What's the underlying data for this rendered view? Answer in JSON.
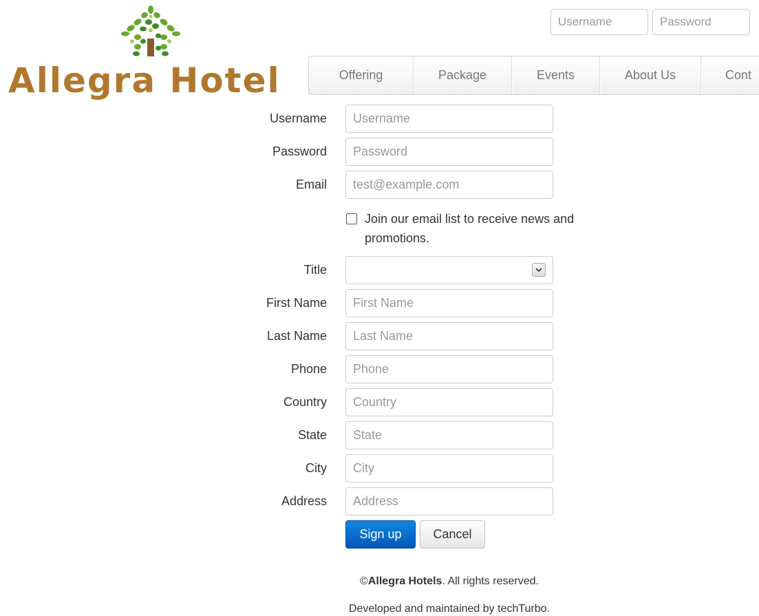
{
  "brand": {
    "name": "Allegra Hotel",
    "color": "#b0782e"
  },
  "top_login": {
    "username_placeholder": "Username",
    "password_placeholder": "Password"
  },
  "nav": {
    "items": [
      "Offering",
      "Package",
      "Events",
      "About Us",
      "Cont"
    ]
  },
  "form": {
    "username": {
      "label": "Username",
      "placeholder": "Username"
    },
    "password": {
      "label": "Password",
      "placeholder": "Password"
    },
    "email": {
      "label": "Email",
      "placeholder": "test@example.com"
    },
    "newsletter": {
      "text": "Join our email list to receive news and promotions.",
      "checked": false
    },
    "title": {
      "label": "Title",
      "value": ""
    },
    "first_name": {
      "label": "First Name",
      "placeholder": "First Name"
    },
    "last_name": {
      "label": "Last Name",
      "placeholder": "Last Name"
    },
    "phone": {
      "label": "Phone",
      "placeholder": "Phone"
    },
    "country": {
      "label": "Country",
      "placeholder": "Country"
    },
    "state": {
      "label": "State",
      "placeholder": "State"
    },
    "city": {
      "label": "City",
      "placeholder": "City"
    },
    "address": {
      "label": "Address",
      "placeholder": "Address"
    }
  },
  "buttons": {
    "signup": "Sign up",
    "cancel": "Cancel",
    "primary_color": "#0b6fd0"
  },
  "footer": {
    "copyright_symbol": "©",
    "company": "Allegra Hotels",
    "rights": ". All rights reserved.",
    "developer": "Developed and maintained by techTurbo."
  },
  "icons": {
    "logo": "tree-house-logo-icon",
    "select": "chevron-down-icon"
  }
}
